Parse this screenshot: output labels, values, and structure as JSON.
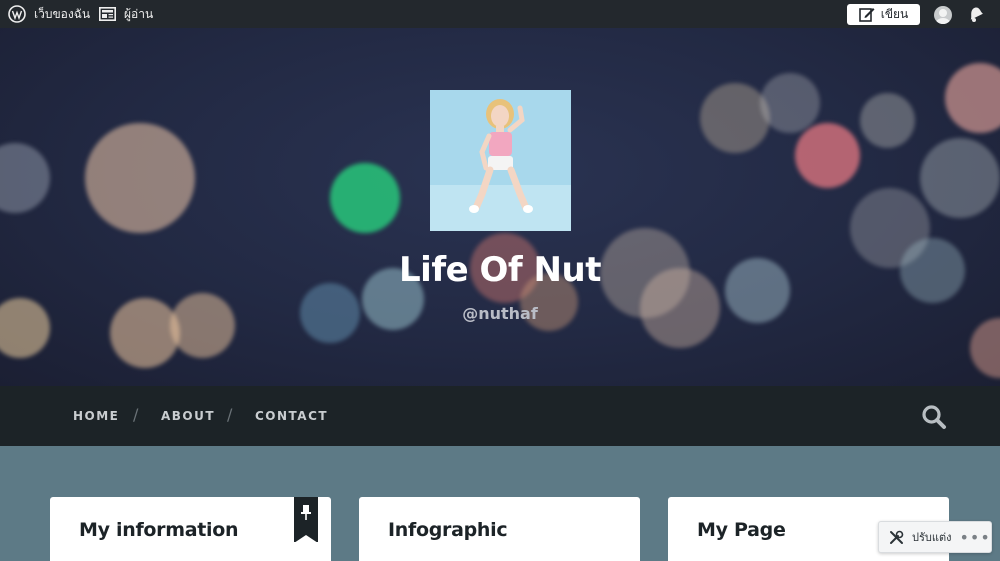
{
  "adminbar": {
    "my_sites_label": "เว็บของฉัน",
    "reader_label": "ผู้อ่าน",
    "write_label": "เขียน"
  },
  "site": {
    "title": "Life Of Nut",
    "description": "@nuthaf"
  },
  "nav": {
    "items": [
      {
        "label": "HOME"
      },
      {
        "label": "ABOUT"
      },
      {
        "label": "CONTACT"
      }
    ],
    "separator": "/"
  },
  "widgets": [
    {
      "title": "My information"
    },
    {
      "title": "Infographic"
    },
    {
      "title": "My Page"
    }
  ],
  "customize": {
    "label": "ปรับแต่ง",
    "more": "•••"
  },
  "colors": {
    "adminbar_bg": "#23282d",
    "nav_bg": "#1c2327",
    "page_bg": "#5d7a86",
    "hero_bg": "#222943"
  }
}
